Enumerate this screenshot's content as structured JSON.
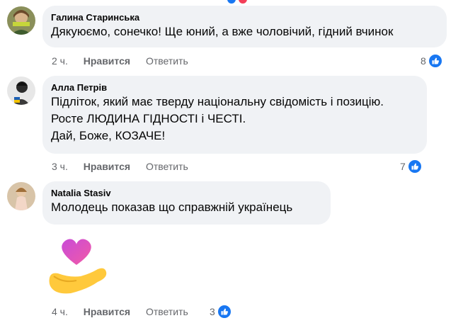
{
  "comments": [
    {
      "author": "Галина Старинська",
      "lines": [
        "Дякуюємо, сонечко! Ще юний, а вже чоловічий, гідний вчинок"
      ],
      "time": "2 ч.",
      "like_label": "Нравится",
      "reply_label": "Ответить",
      "reaction_count": "8"
    },
    {
      "author": "Алла Петрів",
      "lines": [
        "Підліток, який має тверду національну свідомість і позицію.",
        "Росте ЛЮДИНА ГІДНОСТІ і ЧЕСТІ.",
        "Дай, Боже, КОЗАЧЕ!"
      ],
      "time": "3 ч.",
      "like_label": "Нравится",
      "reply_label": "Ответить",
      "reaction_count": "7"
    },
    {
      "author": "Natalia Stasiv",
      "lines": [
        "Молодець показав що справжній українець"
      ],
      "time": "4 ч.",
      "like_label": "Нравится",
      "reply_label": "Ответить",
      "reaction_count": "3",
      "sticker": "heart-hand-sticker"
    }
  ],
  "colors": {
    "bubble": "#f0f2f5",
    "meta": "#65676b",
    "like_blue": "#1877f2"
  },
  "icons": [
    "like-icon",
    "heart-icon",
    "open-hand-icon"
  ]
}
